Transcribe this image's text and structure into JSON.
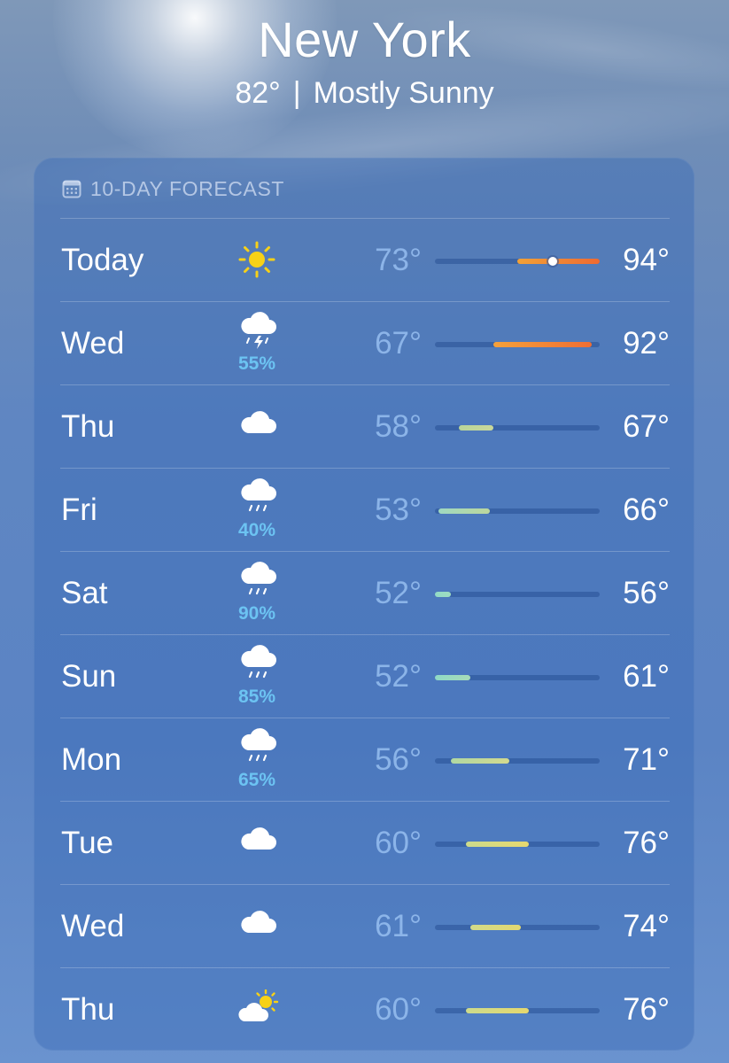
{
  "header": {
    "city": "New York",
    "current_temp": "82°",
    "separator": "|",
    "condition": "Mostly Sunny"
  },
  "forecast": {
    "title": "10-DAY FORECAST",
    "icon": "calendar-icon",
    "range_min": 52,
    "range_max": 94,
    "days": [
      {
        "day": "Today",
        "icon": "sun-icon",
        "pop": "",
        "low": "73°",
        "high": "94°",
        "low_val": 73,
        "high_val": 94,
        "current": 82,
        "colors": [
          "#f2a136",
          "#ef6a32"
        ]
      },
      {
        "day": "Wed",
        "icon": "thunderstorm-icon",
        "pop": "55%",
        "low": "67°",
        "high": "92°",
        "low_val": 67,
        "high_val": 92,
        "colors": [
          "#f5a13a",
          "#ef6e33"
        ]
      },
      {
        "day": "Thu",
        "icon": "cloud-icon",
        "pop": "",
        "low": "58°",
        "high": "67°",
        "low_val": 58,
        "high_val": 67,
        "colors": [
          "#b9d59a",
          "#c9d79a"
        ]
      },
      {
        "day": "Fri",
        "icon": "rain-icon",
        "pop": "40%",
        "low": "53°",
        "high": "66°",
        "low_val": 53,
        "high_val": 66,
        "colors": [
          "#9fd8c0",
          "#bcd79d"
        ]
      },
      {
        "day": "Sat",
        "icon": "rain-icon",
        "pop": "90%",
        "low": "52°",
        "high": "56°",
        "low_val": 52,
        "high_val": 56,
        "colors": [
          "#92dbc7",
          "#9fdcc0"
        ]
      },
      {
        "day": "Sun",
        "icon": "rain-icon",
        "pop": "85%",
        "low": "52°",
        "high": "61°",
        "low_val": 52,
        "high_val": 61,
        "colors": [
          "#8fd9c6",
          "#a7dbb8"
        ]
      },
      {
        "day": "Mon",
        "icon": "rain-icon",
        "pop": "65%",
        "low": "56°",
        "high": "71°",
        "low_val": 56,
        "high_val": 71,
        "colors": [
          "#b0d8a2",
          "#d3d98e"
        ]
      },
      {
        "day": "Tue",
        "icon": "cloud-icon",
        "pop": "",
        "low": "60°",
        "high": "76°",
        "low_val": 60,
        "high_val": 76,
        "colors": [
          "#cddb8c",
          "#e6d86e"
        ]
      },
      {
        "day": "Wed",
        "icon": "cloud-icon",
        "pop": "",
        "low": "61°",
        "high": "74°",
        "low_val": 61,
        "high_val": 74,
        "colors": [
          "#d1da8a",
          "#e3d871"
        ]
      },
      {
        "day": "Thu",
        "icon": "partly-sunny-icon",
        "pop": "",
        "low": "60°",
        "high": "76°",
        "low_val": 60,
        "high_val": 76,
        "colors": [
          "#cddb8c",
          "#e6d86e"
        ]
      }
    ]
  }
}
